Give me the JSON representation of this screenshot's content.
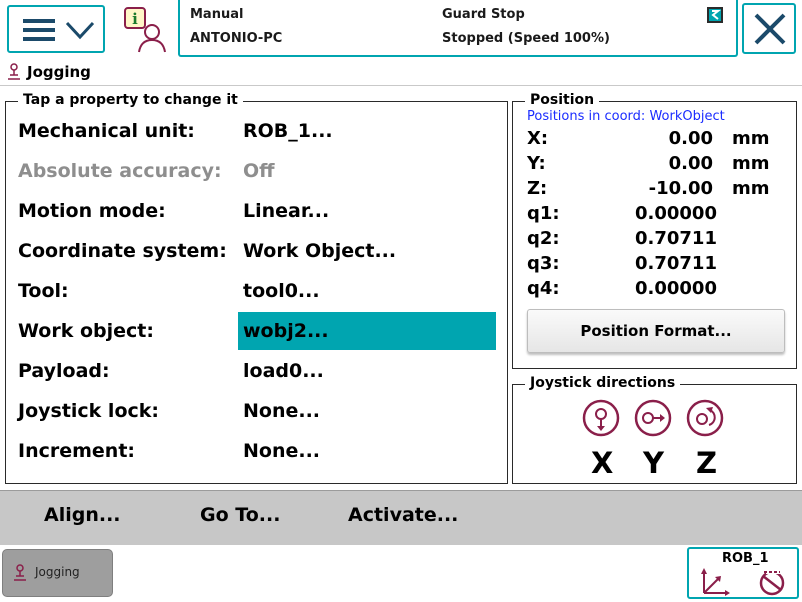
{
  "header": {
    "mode": "Manual",
    "controller": "ANTONIO-PC",
    "guard_state": "Guard Stop",
    "run_state": "Stopped (Speed 100%)"
  },
  "title": "Jogging",
  "properties": {
    "group_label": "Tap a property to change it",
    "rows": [
      {
        "label": "Mechanical unit:",
        "value": "ROB_1..."
      },
      {
        "label": "Absolute accuracy:",
        "value": "Off"
      },
      {
        "label": "Motion mode:",
        "value": "Linear..."
      },
      {
        "label": "Coordinate system:",
        "value": "Work Object..."
      },
      {
        "label": "Tool:",
        "value": "tool0..."
      },
      {
        "label": "Work object:",
        "value": "wobj2..."
      },
      {
        "label": "Payload:",
        "value": "load0..."
      },
      {
        "label": "Joystick lock:",
        "value": "None..."
      },
      {
        "label": "Increment:",
        "value": "None..."
      }
    ]
  },
  "position": {
    "group_label": "Position",
    "coord_caption": "Positions in coord: WorkObject",
    "linear": [
      {
        "label": "X:",
        "value": "0.00",
        "unit": "mm"
      },
      {
        "label": "Y:",
        "value": "0.00",
        "unit": "mm"
      },
      {
        "label": "Z:",
        "value": "-10.00",
        "unit": "mm"
      }
    ],
    "quaternion": [
      {
        "label": "q1:",
        "value": "0.00000"
      },
      {
        "label": "q2:",
        "value": "0.70711"
      },
      {
        "label": "q3:",
        "value": "0.70711"
      },
      {
        "label": "q4:",
        "value": "0.00000"
      }
    ],
    "format_button": "Position Format..."
  },
  "joystick": {
    "group_label": "Joystick directions",
    "axes": [
      "X",
      "Y",
      "Z"
    ]
  },
  "actions": {
    "align": "Align...",
    "goto": "Go To...",
    "activate": "Activate..."
  },
  "taskbar": {
    "jogging": "Jogging",
    "quickset_unit": "ROB_1"
  },
  "colors": {
    "accent": "#00a5b0",
    "selected_value_bg": "#00a5b0",
    "caption_blue": "#1a2cff",
    "icon_maroon": "#8a1f4a"
  },
  "icons": [
    "menu-icon",
    "chevron-down-icon",
    "info-icon",
    "event-log-icon",
    "close-icon",
    "jogging-icon",
    "joystick-x-icon",
    "joystick-y-icon",
    "joystick-z-icon",
    "coordinate-icon",
    "increment-off-icon"
  ]
}
